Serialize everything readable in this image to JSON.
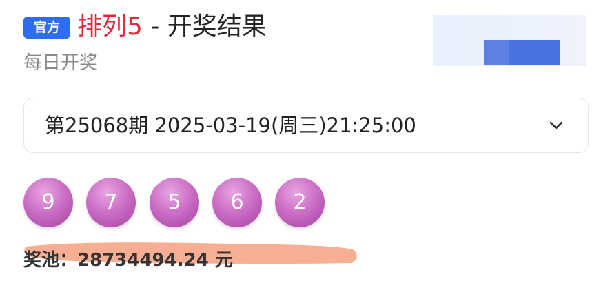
{
  "header": {
    "badge": "官方",
    "game_name": "排列5",
    "title_rest": " - 开奖结果",
    "subtitle": "每日开奖"
  },
  "issue": {
    "selected": "第25068期 2025-03-19(周三)21:25:00"
  },
  "draw": {
    "numbers": [
      "9",
      "7",
      "5",
      "6",
      "2"
    ]
  },
  "pool": {
    "label": "奖池：",
    "amount": "28734494.24",
    "unit": "元"
  },
  "icons": {
    "dropdown": "chevron-down-icon"
  },
  "colors": {
    "badge": "#2f6df0",
    "game_name": "#e02b3a",
    "ball": "#c064bd",
    "highlight": "#f7a789"
  }
}
